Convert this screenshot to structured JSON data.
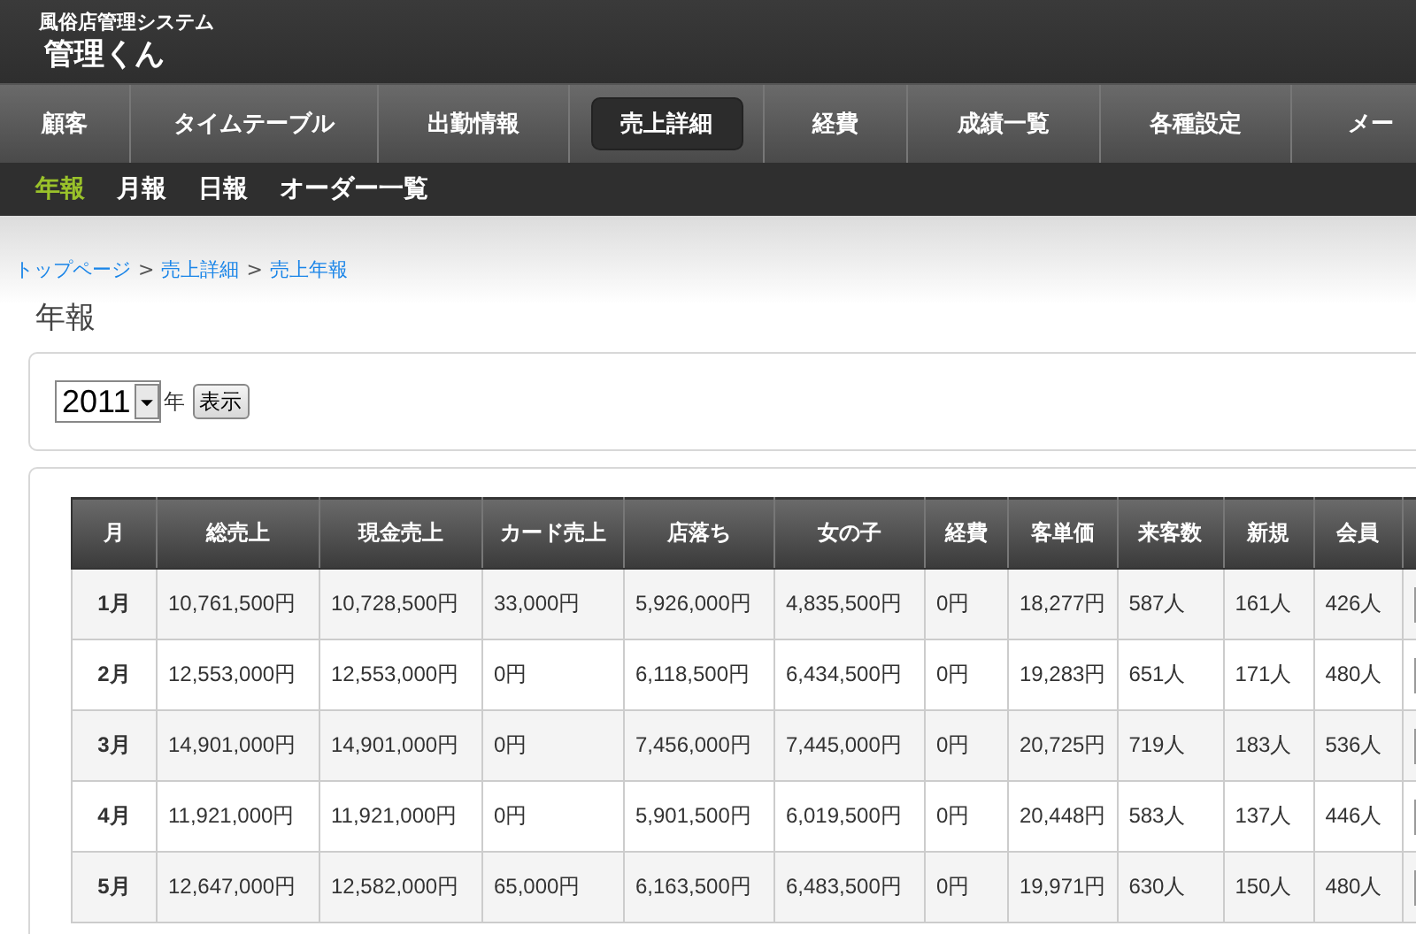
{
  "app": {
    "subtitle": "風俗店管理システム",
    "title": "管理くん"
  },
  "nav": [
    {
      "label": "顧客",
      "selected": false
    },
    {
      "label": "タイムテーブル",
      "selected": false
    },
    {
      "label": "出勤情報",
      "selected": false
    },
    {
      "label": "売上詳細",
      "selected": true
    },
    {
      "label": "経費",
      "selected": false
    },
    {
      "label": "成績一覧",
      "selected": false
    },
    {
      "label": "各種設定",
      "selected": false
    },
    {
      "label": "メー",
      "selected": false
    }
  ],
  "subnav": [
    {
      "label": "年報",
      "selected": true
    },
    {
      "label": "月報",
      "selected": false
    },
    {
      "label": "日報",
      "selected": false
    },
    {
      "label": "オーダー一覧",
      "selected": false
    }
  ],
  "breadcrumb": [
    "トップページ",
    "売上詳細",
    "売上年報"
  ],
  "breadcrumb_separator": ">",
  "page_title": "年報",
  "filter": {
    "year": "2011",
    "unit": "年",
    "button": "表示"
  },
  "table": {
    "columns": [
      "月",
      "総売上",
      "現金売上",
      "カード売上",
      "店落ち",
      "女の子",
      "経費",
      "客単価",
      "来客数",
      "新規",
      "会員"
    ],
    "rows": [
      [
        "1月",
        "10,761,500円",
        "10,728,500円",
        "33,000円",
        "5,926,000円",
        "4,835,500円",
        "0円",
        "18,277円",
        "587人",
        "161人",
        "426人"
      ],
      [
        "2月",
        "12,553,000円",
        "12,553,000円",
        "0円",
        "6,118,500円",
        "6,434,500円",
        "0円",
        "19,283円",
        "651人",
        "171人",
        "480人"
      ],
      [
        "3月",
        "14,901,000円",
        "14,901,000円",
        "0円",
        "7,456,000円",
        "7,445,000円",
        "0円",
        "20,725円",
        "719人",
        "183人",
        "536人"
      ],
      [
        "4月",
        "11,921,000円",
        "11,921,000円",
        "0円",
        "5,901,500円",
        "6,019,500円",
        "0円",
        "20,448円",
        "583人",
        "137人",
        "446人"
      ],
      [
        "5月",
        "12,647,000円",
        "12,582,000円",
        "65,000円",
        "6,163,500円",
        "6,483,500円",
        "0円",
        "19,971円",
        "630人",
        "150人",
        "480人"
      ]
    ]
  }
}
